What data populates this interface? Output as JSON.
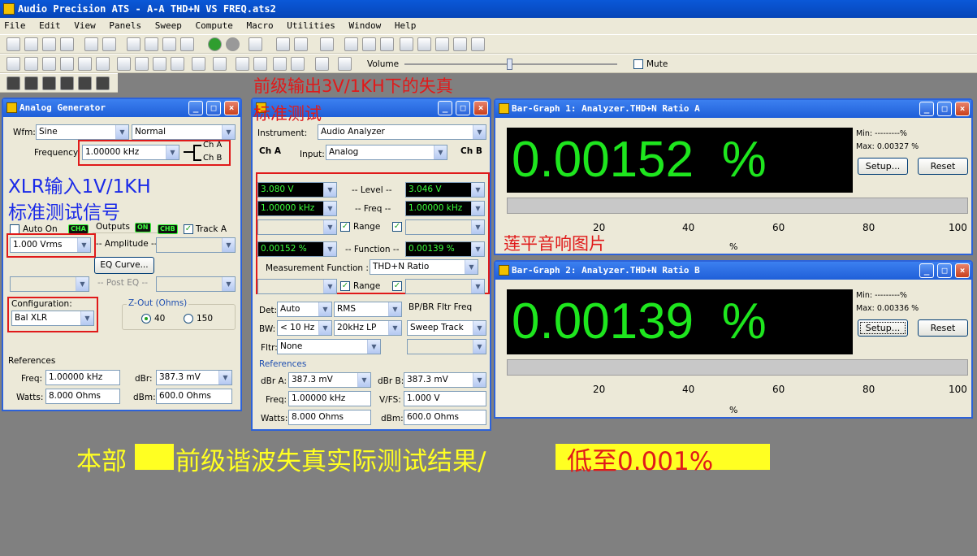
{
  "app": {
    "title": "Audio Precision ATS - A-A THD+N VS FREQ.ats2"
  },
  "menu": [
    "File",
    "Edit",
    "View",
    "Panels",
    "Sweep",
    "Compute",
    "Macro",
    "Utilities",
    "Window",
    "Help"
  ],
  "toolbar": {
    "volume_label": "Volume",
    "mute_label": "Mute"
  },
  "generator": {
    "title": "Analog Generator",
    "wfm_label": "Wfm:",
    "wfm": "Sine",
    "wfm_mode": "Normal",
    "freq_label": "Frequency:",
    "freq": "1.00000 kHz",
    "cha": "Ch A",
    "chb": "Ch B",
    "auto_on": "Auto On",
    "cha_badge": "CHA",
    "outputs": "Outputs",
    "on_badge": "ON",
    "chb_badge": "CHB",
    "track_a": "Track A",
    "amplitude": "1.000   Vrms",
    "amplitude_label": "-- Amplitude --",
    "eq_curve": "EQ Curve...",
    "post_eq": "-- Post EQ --",
    "config_label": "Configuration:",
    "config": "Bal XLR",
    "zout_label": "Z-Out (Ohms)",
    "z40": "40",
    "z150": "150",
    "refs_label": "References",
    "ref_freq_label": "Freq:",
    "ref_freq": "1.00000 kHz",
    "dbr_label": "dBr:",
    "dbr": "387.3   mV",
    "watts_label": "Watts:",
    "watts": "8.000     Ohms",
    "dbm_label": "dBm:",
    "dbm": "600.0     Ohms"
  },
  "analyzer": {
    "instrument_label": "Instrument:",
    "instrument": "Audio Analyzer",
    "cha": "Ch A",
    "chb": "Ch B",
    "input_label": "Input:",
    "input": "Analog",
    "level_a": "3.080   V",
    "level_label": "-- Level --",
    "level_b": "3.046   V",
    "freq_a": "1.00000 kHz",
    "freq_label": "-- Freq --",
    "freq_b": "1.00000 kHz",
    "range_label": "Range",
    "func_a": "0.00152  %",
    "func_label": "-- Function --",
    "func_b": "0.00139  %",
    "meas_label": "Measurement Function :",
    "meas": "THD+N Ratio",
    "range2_label": "Range",
    "det_label": "Det:",
    "det": "Auto",
    "det2": "RMS",
    "bpbr_label": "BP/BR Fltr Freq",
    "bw_label": "BW:",
    "bw": "< 10 Hz",
    "bw2": "20kHz LP",
    "sweep_track": "Sweep Track",
    "fltr_label": "Fltr:",
    "fltr": "None",
    "refs_label": "References",
    "dbra_label": "dBr A:",
    "dbra": "387.3   mV",
    "dbrb_label": "dBr B:",
    "dbrb": "387.3   mV",
    "freq2_label": "Freq:",
    "freq2": "1.00000 kHz",
    "vfs_label": "V/FS:",
    "vfs": "1.000     V",
    "watts_label": "Watts:",
    "watts": "8.000     Ohms",
    "dbm_label": "dBm:",
    "dbm": "600.0     Ohms"
  },
  "bar_a": {
    "title": "Bar-Graph 1: Analyzer.THD+N Ratio A",
    "value": "0.00152  %",
    "min": "Min: ---------%",
    "max": "Max: 0.00327  %",
    "setup": "Setup...",
    "reset": "Reset",
    "ticks": [
      "20",
      "40",
      "60",
      "80",
      "100"
    ],
    "unit": "%"
  },
  "bar_b": {
    "title": "Bar-Graph 2: Analyzer.THD+N Ratio B",
    "value": "0.00139  %",
    "min": "Min: ---------%",
    "max": "Max: 0.00336  %",
    "setup": "Setup...",
    "reset": "Reset",
    "ticks": [
      "20",
      "40",
      "60",
      "80",
      "100"
    ],
    "unit": "%"
  },
  "annotations": {
    "top1": "前级输出3V/1KH下的失真",
    "top2": "标准测试",
    "left1": "XLR输入1V/1KH",
    "left2": "标准测试信号",
    "right": "莲平音响图片",
    "bottom_a": "本部",
    "bottom_b": "前级谐波失真实际测试结果/",
    "bottom_c": "低至0.001%"
  },
  "colors": {
    "accent": "#2d62d8",
    "readout": "#1ee61e",
    "annotation_blue": "#1a2ae8",
    "annotation_red": "#e01a1a",
    "annotation_yellow": "#ffff22"
  }
}
